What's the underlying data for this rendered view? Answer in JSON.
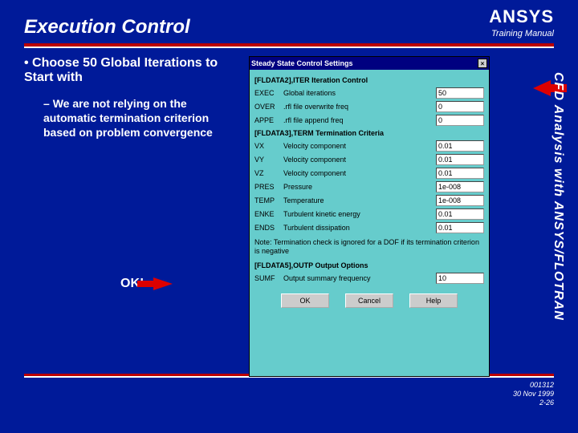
{
  "header": {
    "title": "Execution Control",
    "brand": "ANSYS",
    "subtitle": "Training Manual"
  },
  "bullets": {
    "main": "Choose 50 Global Iterations to Start with",
    "sub": "We are not relying on the automatic termination criterion based on problem convergence"
  },
  "ok_label": "OK!",
  "side_text": "CFD Analysis with ANSYS/FLOTRAN",
  "dialog": {
    "title": "Steady State Control Settings",
    "section1": "[FLDATA2],ITER   Iteration Control",
    "rows1": [
      {
        "key": "EXEC",
        "label": "Global iterations",
        "val": "50"
      },
      {
        "key": "OVER",
        "label": ".rfl file overwrite freq",
        "val": "0"
      },
      {
        "key": "APPE",
        "label": ".rfl file append freq",
        "val": "0"
      }
    ],
    "section2": "[FLDATA3],TERM   Termination Criteria",
    "rows2": [
      {
        "key": "VX",
        "label": "Velocity component",
        "val": "0.01"
      },
      {
        "key": "VY",
        "label": "Velocity component",
        "val": "0.01"
      },
      {
        "key": "VZ",
        "label": "Velocity component",
        "val": "0.01"
      },
      {
        "key": "PRES",
        "label": "Pressure",
        "val": "1e-008"
      },
      {
        "key": "TEMP",
        "label": "Temperature",
        "val": "1e-008"
      },
      {
        "key": "ENKE",
        "label": "Turbulent kinetic energy",
        "val": "0.01"
      },
      {
        "key": "ENDS",
        "label": "Turbulent dissipation",
        "val": "0.01"
      }
    ],
    "note": "Note: Termination check is ignored for a DOF if its termination criterion is negative",
    "section3": "[FLDATA5],OUTP   Output Options",
    "rows3": [
      {
        "key": "SUMF",
        "label": "Output summary frequency",
        "val": "10"
      }
    ],
    "buttons": {
      "ok": "OK",
      "cancel": "Cancel",
      "help": "Help"
    }
  },
  "footer": {
    "code": "001312",
    "date": "30 Nov 1999",
    "page": "2-26"
  }
}
